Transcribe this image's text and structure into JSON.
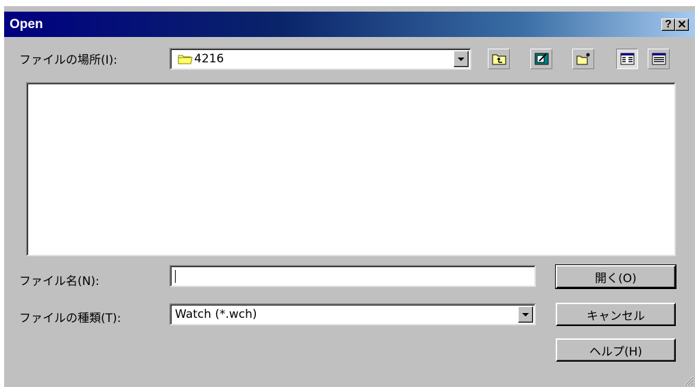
{
  "window": {
    "title": "Open",
    "help_glyph": "?",
    "close_glyph": "✕"
  },
  "look_in": {
    "label": "ファイルの場所(I):",
    "value": "4216",
    "folder_icon": "folder-icon"
  },
  "toolbar": {
    "buttons": [
      "up-one-level-icon",
      "desktop-icon",
      "new-folder-icon",
      "list-view-icon",
      "details-view-icon"
    ]
  },
  "file_name": {
    "label": "ファイル名(N):",
    "value": ""
  },
  "file_type": {
    "label": "ファイルの種類(T):",
    "value": "Watch (*.wch)"
  },
  "buttons": {
    "open": "開く(O)",
    "cancel": "キャンセル",
    "help": "ヘルプ(H)"
  },
  "colors": {
    "face": "#c0c0c0",
    "title_start": "#000080",
    "title_end": "#a6caf0"
  }
}
